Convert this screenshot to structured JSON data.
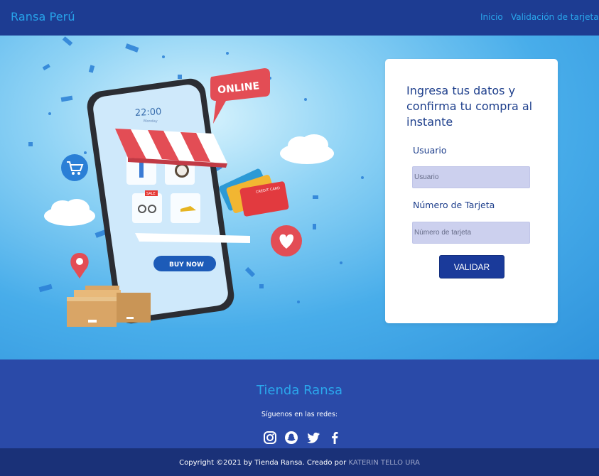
{
  "nav": {
    "brand": "Ransa Perú",
    "links": [
      "Inicio",
      "Validación de tarjeta"
    ]
  },
  "hero_art": {
    "online_badge": "ONLINE",
    "phone_time": "22:00",
    "phone_date": "Monday",
    "buy_button": "BUY NOW",
    "sale_tag": "SALE",
    "card_text": "CREDIT CARD"
  },
  "form": {
    "title": "Ingresa tus datos y confirma tu compra al instante",
    "user_label": "Usuario",
    "user_placeholder": "Usuario",
    "card_label": "Número de Tarjeta",
    "card_placeholder": "Número de tarjeta",
    "submit": "VALIDAR"
  },
  "footer": {
    "title": "Tienda Ransa",
    "subtitle": "Síguenos en las redes:",
    "social": [
      "instagram-icon",
      "snapchat-icon",
      "twitter-icon",
      "facebook-icon"
    ],
    "copyright_prefix": "Copyright ©2021 by Tienda Ransa. Creado por",
    "author": "KATERIN TELLO URA"
  },
  "colors": {
    "navbar": "#1d3c92",
    "accent": "#27a3ea",
    "button": "#1a3a9a",
    "input": "#ccd0ee",
    "footer": "#2a4aa8",
    "copyright_bar": "#1a3178"
  }
}
